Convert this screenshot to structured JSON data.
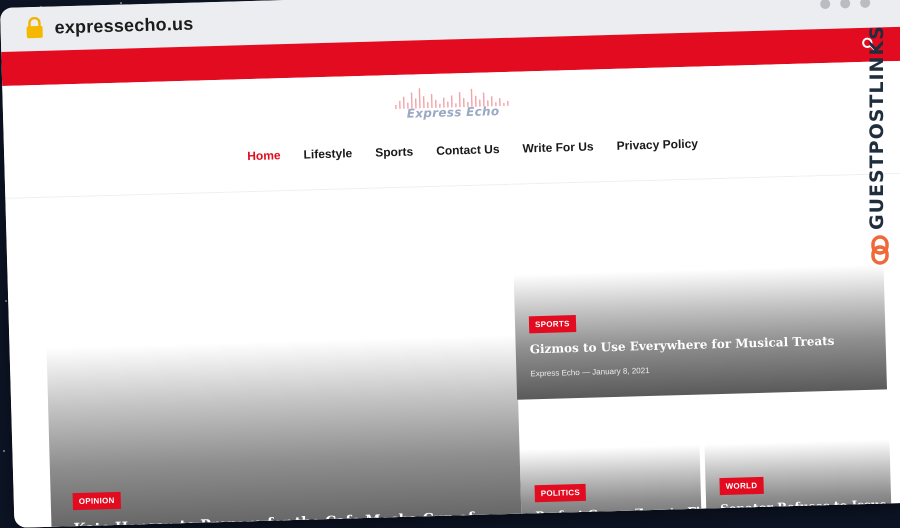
{
  "browser": {
    "url": "expressecho.us"
  },
  "site": {
    "logo_text": "Express Echo"
  },
  "nav": {
    "items": [
      "Home",
      "Lifestyle",
      "Sports",
      "Contact Us",
      "Write For Us",
      "Privacy Policy"
    ],
    "active": "Home"
  },
  "posts": {
    "featured": {
      "category": "OPINION",
      "title": "Kate Hanson to Prepare for the Cafe Mocha Cup of"
    },
    "top_right": {
      "category": "SPORTS",
      "title": "Gizmos to Use Everywhere for Musical Treats",
      "author": "Express Echo",
      "separator": "—",
      "date": "January 8, 2021"
    },
    "bottom_left": {
      "category": "POLITICS",
      "title": "Perfect Game: Zero to Five"
    },
    "bottom_right": {
      "category": "WORLD",
      "title": "Senator Refuses to Issue a"
    }
  },
  "watermark": {
    "text": "GUESTPOSTLINKS"
  },
  "colors": {
    "accent": "#e30b1f",
    "chrome": "#ebedf0",
    "background": "#0d1526"
  },
  "icons": [
    "lock-icon",
    "search-icon",
    "link-icon"
  ]
}
